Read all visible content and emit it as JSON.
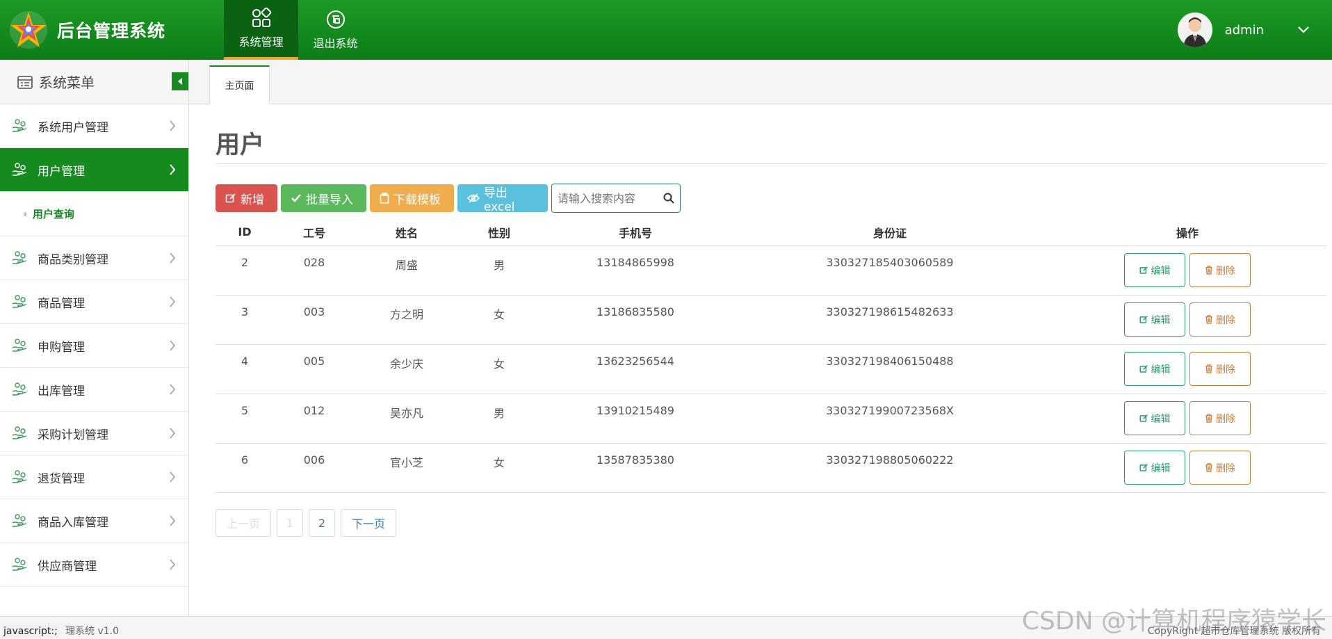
{
  "header": {
    "title": "后台管理系统",
    "nav": [
      {
        "label": "系统管理",
        "icon": "grid-icon",
        "active": true
      },
      {
        "label": "退出系统",
        "icon": "exit-badge-icon",
        "active": false
      }
    ],
    "username": "admin"
  },
  "sidebar": {
    "title": "系统菜单",
    "items": [
      {
        "label": "系统用户管理"
      },
      {
        "label": "用户管理",
        "active": true
      },
      {
        "label": "商品类别管理"
      },
      {
        "label": "商品管理"
      },
      {
        "label": "申购管理"
      },
      {
        "label": "出库管理"
      },
      {
        "label": "采购计划管理"
      },
      {
        "label": "退货管理"
      },
      {
        "label": "商品入库管理"
      },
      {
        "label": "供应商管理"
      }
    ],
    "sub_item": "用户查询"
  },
  "tabs": [
    {
      "label": "主页面"
    }
  ],
  "main": {
    "title": "用户",
    "toolbar": {
      "add": "新增",
      "import": "批量导入",
      "template": "下载模板",
      "export": "导出excel",
      "search_placeholder": "请输入搜索内容"
    },
    "table": {
      "columns": [
        "ID",
        "工号",
        "姓名",
        "性别",
        "手机号",
        "身份证",
        "操作"
      ],
      "rows": [
        {
          "id": "2",
          "no": "028",
          "name": "周盛",
          "gender": "男",
          "phone": "13184865998",
          "idcard": "330327185403060589"
        },
        {
          "id": "3",
          "no": "003",
          "name": "方之明",
          "gender": "女",
          "phone": "13186835580",
          "idcard": "330327198615482633"
        },
        {
          "id": "4",
          "no": "005",
          "name": "余少庆",
          "gender": "女",
          "phone": "13623256544",
          "idcard": "330327198406150488"
        },
        {
          "id": "5",
          "no": "012",
          "name": "吴亦凡",
          "gender": "男",
          "phone": "13910215489",
          "idcard": "33032719900723568X"
        },
        {
          "id": "6",
          "no": "006",
          "name": "官小芝",
          "gender": "女",
          "phone": "13587835380",
          "idcard": "330327198805060222"
        }
      ],
      "edit_label": "编辑",
      "delete_label": "删除"
    },
    "pager": {
      "prev": "上一页",
      "page1": "1",
      "page2": "2",
      "next": "下一页"
    }
  },
  "footer": {
    "status_url": "javascript:;",
    "left": "理系统 v1.0",
    "right": "CopyRight 超市仓库管理系统 版权所有"
  },
  "watermark": "CSDN @计算机程序猿学长",
  "colors": {
    "brand": "#158a1f",
    "red": "#d9534f",
    "green": "#5cb85c",
    "orange": "#f0ad4e",
    "blue": "#5bc0de"
  }
}
